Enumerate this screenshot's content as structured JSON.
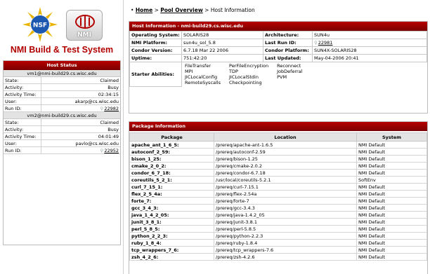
{
  "logos": {
    "nsf": "NSF",
    "nmi": "NMI"
  },
  "site_title": "NMI Build & Test System",
  "host_status": {
    "header": "Host Status",
    "vms": [
      {
        "title": "vm1@nmi-build29.cs.wisc.edu",
        "rows": [
          {
            "key": "State:",
            "value": "Claimed"
          },
          {
            "key": "Activity:",
            "value": "Busy"
          },
          {
            "key": "Activity Time:",
            "value": "02:34:15"
          },
          {
            "key": "User:",
            "value": "akarp@cs.wisc.edu"
          },
          {
            "key": "Run ID:",
            "value": "22982"
          }
        ]
      },
      {
        "title": "vm2@nmi-build29.cs.wisc.edu",
        "rows": [
          {
            "key": "State:",
            "value": "Claimed"
          },
          {
            "key": "Activity:",
            "value": "Busy"
          },
          {
            "key": "Activity Time:",
            "value": "04:01:49"
          },
          {
            "key": "User:",
            "value": "pavlo@cs.wisc.edu"
          },
          {
            "key": "Run ID:",
            "value": "22952"
          }
        ]
      }
    ]
  },
  "breadcrumb": {
    "bullet": "•",
    "home": "Home",
    "sep1": ">",
    "pool": "Pool Overview",
    "sep2": ">",
    "current": "Host Information"
  },
  "host_info": {
    "header": "Host Information - nmi-build29.cs.wisc.edu",
    "rows": [
      {
        "l1": "Operating System:",
        "v1": "SOLARIS28",
        "l2": "Architecture:",
        "v2": "SUN4u"
      },
      {
        "l1": "NMI Platform:",
        "v1": "sun4u_sol_5.8",
        "l2": "Last Run ID:",
        "v2": "22981"
      },
      {
        "l1": "Condor Version:",
        "v1": "6.7.18 Mar 22 2006",
        "l2": "Condor Platform:",
        "v2": "SUN4X-SOLARIS28"
      },
      {
        "l1": "Uptime:",
        "v1": "751:42:20",
        "l2": "Last Updated:",
        "v2": "May-04-2006 20:41"
      }
    ],
    "starter_label": "Starter Abilities:",
    "abilities": [
      [
        "FileTransfer",
        "MPI",
        "JICLocalConfig",
        "RemoteSyscalls"
      ],
      [
        "PerFileEncryption",
        "TDP",
        "JICLocalStdin",
        "Checkpointing"
      ],
      [
        "Reconnect",
        "JobDeferral",
        "PVM"
      ]
    ]
  },
  "packages": {
    "header": "Package Information",
    "columns": [
      "Package",
      "Location",
      "System"
    ],
    "rows": [
      [
        "apache_ant_1_6_5:",
        "/prereq/apache-ant-1.6.5",
        "NMI Default"
      ],
      [
        "autoconf_2_59:",
        "/prereq/autoconf-2.59",
        "NMI Default"
      ],
      [
        "bison_1_25:",
        "/prereq/bison-1.25",
        "NMI Default"
      ],
      [
        "cmake_2_0_2:",
        "/prereq/cmake-2.0.2",
        "NMI Default"
      ],
      [
        "condor_6_7_18:",
        "/prereq/condor-6.7.18",
        "NMI Default"
      ],
      [
        "coreutils_5_2_1:",
        "/usr/local/coreutils-5.2.1",
        "SoftEnv"
      ],
      [
        "curl_7_15_1:",
        "/prereq/curl-7.15.1",
        "NMI Default"
      ],
      [
        "flex_2_5_4a:",
        "/prereq/flex-2.54a",
        "NMI Default"
      ],
      [
        "forte_7:",
        "/prereq/forte-7",
        "NMI Default"
      ],
      [
        "gcc_3_4_3:",
        "/prereq/gcc-3.4.3",
        "NMI Default"
      ],
      [
        "java_1_4_2_05:",
        "/prereq/java-1.4.2_05",
        "NMI Default"
      ],
      [
        "junit_3_8_1:",
        "/prereq/junit-3.8.1",
        "NMI Default"
      ],
      [
        "perl_5_8_5:",
        "/prereq/perl-5.8.5",
        "NMI Default"
      ],
      [
        "python_2_2_3:",
        "/prereq/python-2.2.3",
        "NMI Default"
      ],
      [
        "ruby_1_8_4:",
        "/prereq/ruby-1.8.4",
        "NMI Default"
      ],
      [
        "tcp_wrappers_7_6:",
        "/prereq/tcp_wrappers-7.6",
        "NMI Default"
      ],
      [
        "zsh_4_2_6:",
        "/prereq/zsh-4.2.6",
        "NMI Default"
      ]
    ]
  },
  "colors": {
    "accent": "#b20000",
    "header_dark": "#7a0000"
  }
}
